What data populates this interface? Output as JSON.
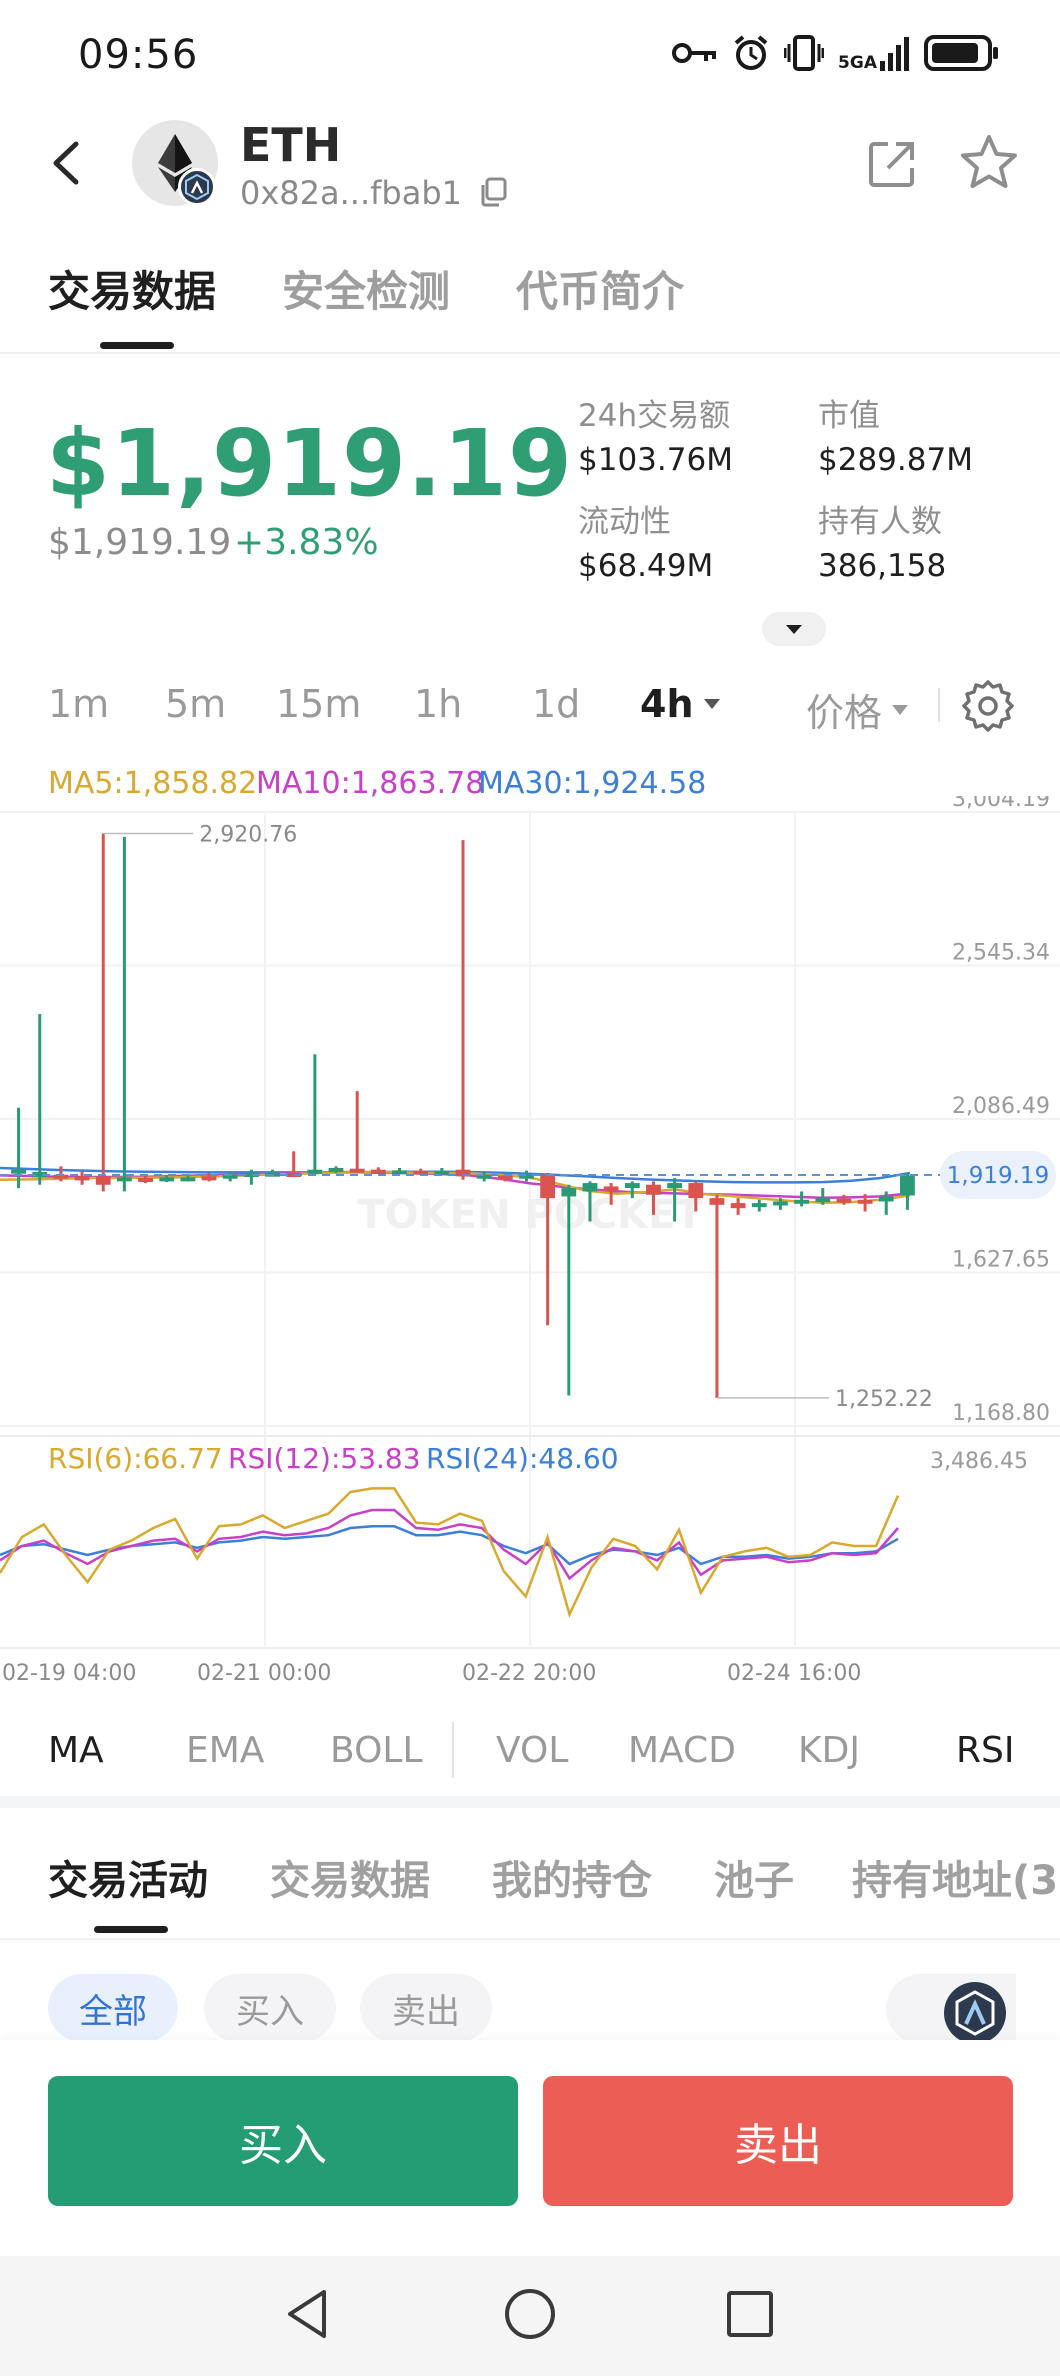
{
  "status_bar": {
    "time": "09:56",
    "network": "5GA"
  },
  "header": {
    "token_name": "ETH",
    "address": "0x82a...fbab1"
  },
  "tabs": [
    "交易数据",
    "安全检测",
    "代币简介"
  ],
  "price": {
    "main": "$1,919.19",
    "sub": "$1,919.19",
    "change": "+3.83%"
  },
  "stats": [
    {
      "label": "24h交易额",
      "value": "$103.76M"
    },
    {
      "label": "市值",
      "value": "$289.87M"
    },
    {
      "label": "流动性",
      "value": "$68.49M"
    },
    {
      "label": "持有人数",
      "value": "386,158"
    }
  ],
  "timeframes": [
    "1m",
    "5m",
    "15m",
    "1h",
    "1d",
    "4h"
  ],
  "active_timeframe": "4h",
  "price_mode": "价格",
  "ma_legend": {
    "ma5": "MA5:1,858.82",
    "ma10": "MA10:1,863.78",
    "ma30": "MA30:1,924.58"
  },
  "chart_data": {
    "type": "candlestick",
    "y_ticks": [
      "3,004.19",
      "2,545.34",
      "2,086.49",
      "1,627.65",
      "1,168.80"
    ],
    "y_range": [
      1168.8,
      3004.19
    ],
    "high_label": "2,920.76",
    "low_label": "1,252.22",
    "current_label": "1,919.19",
    "watermark": "TOKEN POCKET",
    "x_labels": [
      "02-19 04:00",
      "02-21 00:00",
      "02-22 20:00",
      "02-24 16:00"
    ],
    "candles": [
      [
        1925,
        1935,
        1880,
        2120,
        "up"
      ],
      [
        1912,
        1928,
        1890,
        2400,
        "up"
      ],
      [
        1920,
        1910,
        1900,
        1945,
        "down"
      ],
      [
        1915,
        1905,
        1890,
        1930,
        "down"
      ],
      [
        1915,
        1890,
        1870,
        2940,
        "down"
      ],
      [
        1905,
        1912,
        1870,
        2930,
        "up"
      ],
      [
        1910,
        1905,
        1895,
        1920,
        "down"
      ],
      [
        1905,
        1912,
        1898,
        1918,
        "up"
      ],
      [
        1908,
        1912,
        1900,
        1920,
        "up"
      ],
      [
        1915,
        1908,
        1900,
        1925,
        "down"
      ],
      [
        1912,
        1920,
        1900,
        1930,
        "up"
      ],
      [
        1918,
        1925,
        1890,
        1935,
        "up"
      ],
      [
        1922,
        1926,
        1915,
        1935,
        "up"
      ],
      [
        1925,
        1922,
        1915,
        1990,
        "down"
      ],
      [
        1930,
        1935,
        1920,
        2280,
        "up"
      ],
      [
        1933,
        1940,
        1925,
        1945,
        "up"
      ],
      [
        1938,
        1935,
        1925,
        2170,
        "down"
      ],
      [
        1935,
        1932,
        1925,
        1942,
        "down"
      ],
      [
        1930,
        1933,
        1925,
        1940,
        "up"
      ],
      [
        1932,
        1930,
        1920,
        1938,
        "down"
      ],
      [
        1930,
        1932,
        1920,
        1940,
        "up"
      ],
      [
        1935,
        1915,
        1905,
        2920,
        "down"
      ],
      [
        1915,
        1920,
        1900,
        1930,
        "up"
      ],
      [
        1918,
        1910,
        1900,
        1925,
        "down"
      ],
      [
        1915,
        1920,
        1900,
        1932,
        "up"
      ],
      [
        1920,
        1850,
        1470,
        1925,
        "down"
      ],
      [
        1855,
        1880,
        1260,
        1890,
        "up"
      ],
      [
        1870,
        1895,
        1780,
        1900,
        "up"
      ],
      [
        1885,
        1875,
        1830,
        1895,
        "down"
      ],
      [
        1880,
        1895,
        1850,
        1900,
        "up"
      ],
      [
        1890,
        1860,
        1800,
        1900,
        "down"
      ],
      [
        1880,
        1895,
        1780,
        1910,
        "up"
      ],
      [
        1895,
        1850,
        1810,
        1900,
        "down"
      ],
      [
        1850,
        1830,
        1253,
        1860,
        "down"
      ],
      [
        1835,
        1820,
        1800,
        1850,
        "down"
      ],
      [
        1825,
        1835,
        1810,
        1845,
        "up"
      ],
      [
        1830,
        1840,
        1815,
        1850,
        "up"
      ],
      [
        1838,
        1845,
        1825,
        1870,
        "up"
      ],
      [
        1845,
        1850,
        1830,
        1880,
        "up"
      ],
      [
        1848,
        1842,
        1830,
        1860,
        "down"
      ],
      [
        1845,
        1840,
        1810,
        1862,
        "down"
      ],
      [
        1840,
        1855,
        1800,
        1870,
        "up"
      ],
      [
        1858,
        1918,
        1815,
        1925,
        "up"
      ]
    ],
    "ma_series": {
      "ma5": [
        1905,
        1906,
        1908,
        1910,
        1910,
        1911,
        1912,
        1914,
        1917,
        1920,
        1922,
        1925,
        1927,
        1928,
        1926,
        1925,
        1924,
        1920,
        1912,
        1893,
        1872,
        1863,
        1868,
        1876,
        1862,
        1855,
        1848,
        1841,
        1836,
        1838,
        1845,
        1858
      ],
      "ma10": [
        1918,
        1916,
        1914,
        1913,
        1913,
        1914,
        1916,
        1918,
        1920,
        1922,
        1924,
        1926,
        1927,
        1926,
        1925,
        1922,
        1918,
        1908,
        1895,
        1885,
        1877,
        1870,
        1866,
        1864,
        1862,
        1860,
        1857,
        1854,
        1851,
        1852,
        1855,
        1864
      ],
      "ma30": [
        1940,
        1937,
        1934,
        1932,
        1930,
        1929,
        1928,
        1927,
        1927,
        1927,
        1927,
        1927,
        1928,
        1928,
        1929,
        1929,
        1928,
        1926,
        1923,
        1919,
        1915,
        1910,
        1906,
        1903,
        1900,
        1898,
        1897,
        1897,
        1898,
        1902,
        1910,
        1925
      ]
    },
    "rsi_legend": {
      "rsi6": "RSI(6):66.77",
      "rsi12": "RSI(12):53.83",
      "rsi24": "RSI(24):48.60"
    },
    "rsi_top_label": "3,486.45",
    "rsi_series": {
      "rsi6": [
        35,
        55,
        62,
        45,
        30,
        48,
        53,
        60,
        65,
        43,
        61,
        62,
        67,
        60,
        64,
        68,
        80,
        82,
        82,
        63,
        62,
        68,
        64,
        36,
        22,
        55,
        12,
        38,
        54,
        50,
        37,
        59,
        24,
        44,
        47,
        49,
        44,
        45,
        52,
        50,
        50,
        78
      ],
      "rsi12": [
        42,
        50,
        53,
        46,
        40,
        47,
        50,
        53,
        54,
        47,
        54,
        55,
        58,
        56,
        57,
        60,
        67,
        70,
        70,
        60,
        59,
        62,
        60,
        48,
        40,
        52,
        32,
        42,
        49,
        47,
        42,
        52,
        34,
        42,
        43,
        44,
        41,
        42,
        46,
        45,
        46,
        60
      ],
      "rsi24": [
        45,
        50,
        51,
        48,
        45,
        48,
        50,
        51,
        52,
        49,
        52,
        53,
        55,
        54,
        55,
        56,
        60,
        61,
        61,
        56,
        56,
        58,
        56,
        50,
        46,
        51,
        40,
        45,
        48,
        47,
        45,
        49,
        40,
        44,
        44,
        45,
        43,
        44,
        46,
        46,
        47,
        54
      ]
    }
  },
  "indicators": [
    "MA",
    "EMA",
    "BOLL",
    "VOL",
    "MACD",
    "KDJ",
    "RSI"
  ],
  "activity_tabs": [
    "交易活动",
    "交易数据",
    "我的持仓",
    "池子",
    "持有地址(3"
  ],
  "filters": [
    "全部",
    "买入",
    "卖出"
  ],
  "actions": {
    "buy": "买入",
    "sell": "卖出"
  },
  "colors": {
    "up": "#2a9a76",
    "down": "#d9534f",
    "ma5": "#d8a92e",
    "ma10": "#c83fc8",
    "ma30": "#3b7fd9"
  }
}
